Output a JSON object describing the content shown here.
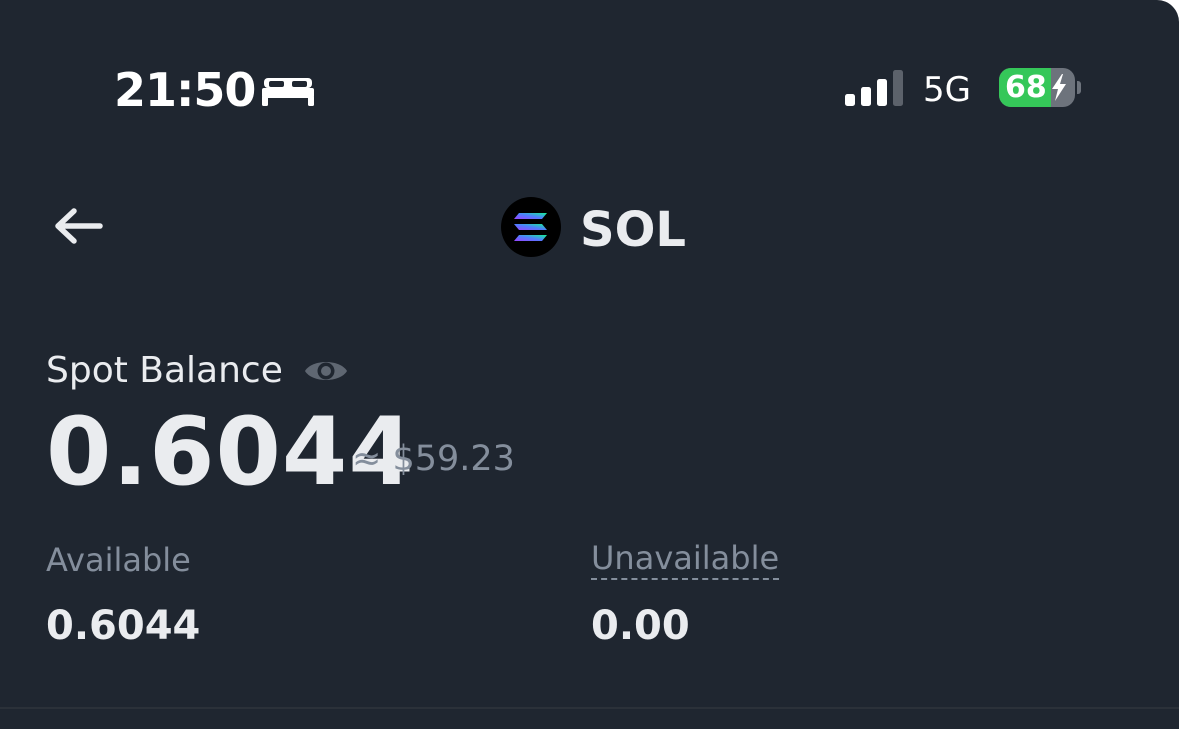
{
  "status_bar": {
    "time": "21:50",
    "focus_icon": "bed-icon",
    "signal_icon": "cellular-signal-icon",
    "network": "5G",
    "battery_level": "68",
    "battery_fraction": 0.68,
    "battery_charging": true,
    "battery_color": "#35c759"
  },
  "header": {
    "back_icon": "arrow-left-icon",
    "coin_icon": "solana-logo",
    "title": "SOL"
  },
  "balance": {
    "label": "Spot Balance",
    "visibility_icon": "eye-icon",
    "amount": "0.6044",
    "fiat_equivalent": "≈ $59.23"
  },
  "breakdown": {
    "available_label": "Available",
    "available_value": "0.6044",
    "unavailable_label": "Unavailable",
    "unavailable_value": "0.00"
  },
  "colors": {
    "background": "#1f2630",
    "primary_text": "#eaecef",
    "secondary_text": "#848e9c"
  }
}
